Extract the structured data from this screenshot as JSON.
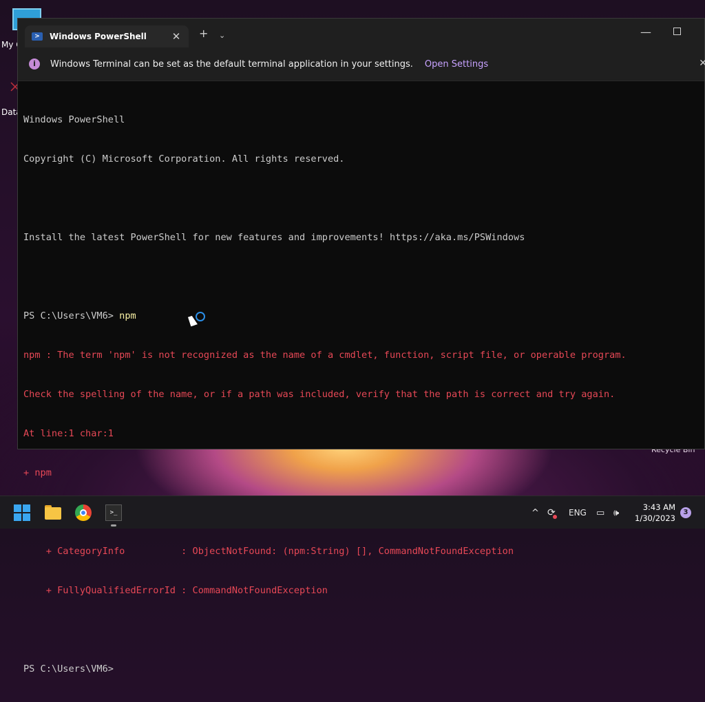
{
  "desktop": {
    "icon_pc_label": "My C",
    "icon_data_label": "Data",
    "recycle_bin_label": "Recycle Bin"
  },
  "window": {
    "tab_title": "Windows PowerShell",
    "tab_close": "✕",
    "new_tab": "+",
    "dropdown": "⌄",
    "minimize": "—"
  },
  "infobar": {
    "icon_glyph": "i",
    "message": "Windows Terminal can be set as the default terminal application in your settings.",
    "link": "Open Settings",
    "close": "✕"
  },
  "console": {
    "lines": [
      {
        "text": "Windows PowerShell",
        "style": "normal"
      },
      {
        "text": "Copyright (C) Microsoft Corporation. All rights reserved.",
        "style": "normal"
      },
      {
        "text": "",
        "style": "normal"
      },
      {
        "text": "Install the latest PowerShell for new features and improvements! https://aka.ms/PSWindows",
        "style": "normal"
      },
      {
        "text": "",
        "style": "normal"
      },
      {
        "text": "PS C:\\Users\\VM6> ",
        "style": "prompt",
        "command": "npm"
      },
      {
        "text": "npm : The term 'npm' is not recognized as the name of a cmdlet, function, script file, or operable program.",
        "style": "error"
      },
      {
        "text": "Check the spelling of the name, or if a path was included, verify that the path is correct and try again.",
        "style": "error"
      },
      {
        "text": "At line:1 char:1",
        "style": "error"
      },
      {
        "text": "+ npm",
        "style": "error"
      },
      {
        "text": "+ ~~~",
        "style": "error"
      },
      {
        "text": "    + CategoryInfo          : ObjectNotFound: (npm:String) [], CommandNotFoundException",
        "style": "error"
      },
      {
        "text": "    + FullyQualifiedErrorId : CommandNotFoundException",
        "style": "error"
      },
      {
        "text": "",
        "style": "normal"
      },
      {
        "text": "PS C:\\Users\\VM6>",
        "style": "normal"
      }
    ]
  },
  "taskbar": {
    "terminal_glyph": ">_",
    "tray": {
      "chevron": "^",
      "sync_icon": "⟳",
      "language": "ENG",
      "network_icon": "▭",
      "volume_icon": "🕪"
    },
    "time": "3:43 AM",
    "date": "1/30/2023",
    "notification_count": "3"
  },
  "colors": {
    "console_bg": "#0c0c0c",
    "console_text": "#cccccc",
    "command_text": "#f9f1a5",
    "error_text": "#e74856",
    "link": "#c7a2ff",
    "accent": "#3aa6f0"
  }
}
